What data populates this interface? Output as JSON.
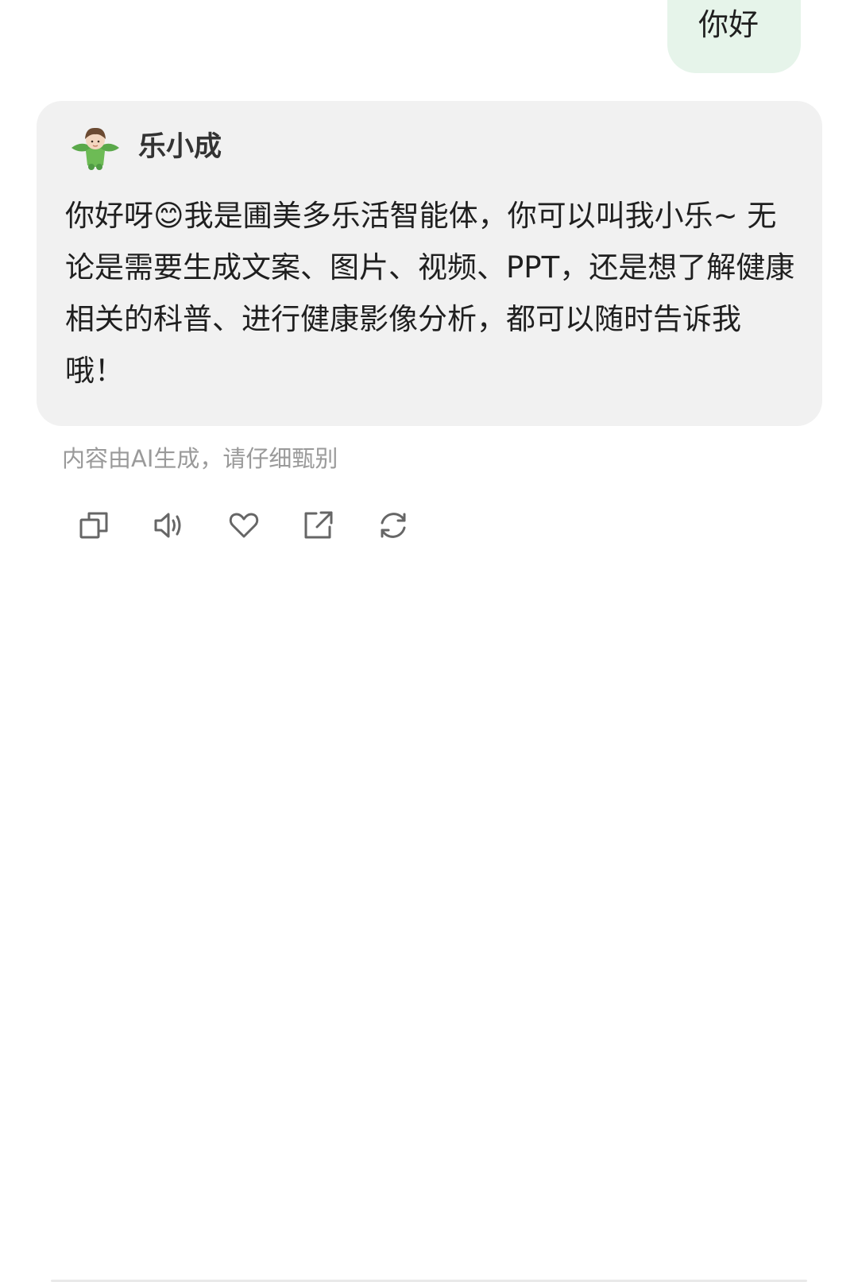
{
  "user_message": {
    "text": "你好",
    "bubble_color": "#e6f4ea"
  },
  "assistant": {
    "name": "乐小成",
    "avatar_icon": "green-leaf-doll-avatar",
    "message": "你好呀😊我是圃美多乐活智能体，你可以叫我小乐~ 无论是需要生成文案、图片、视频、PPT，还是想了解健康相关的科普、进行健康影像分析，都可以随时告诉我哦！",
    "card_color": "#f1f1f1"
  },
  "disclaimer": "内容由AI生成，请仔细甄别",
  "actions": [
    {
      "icon": "copy-icon"
    },
    {
      "icon": "speaker-icon"
    },
    {
      "icon": "heart-icon"
    },
    {
      "icon": "share-icon"
    },
    {
      "icon": "refresh-icon"
    }
  ]
}
